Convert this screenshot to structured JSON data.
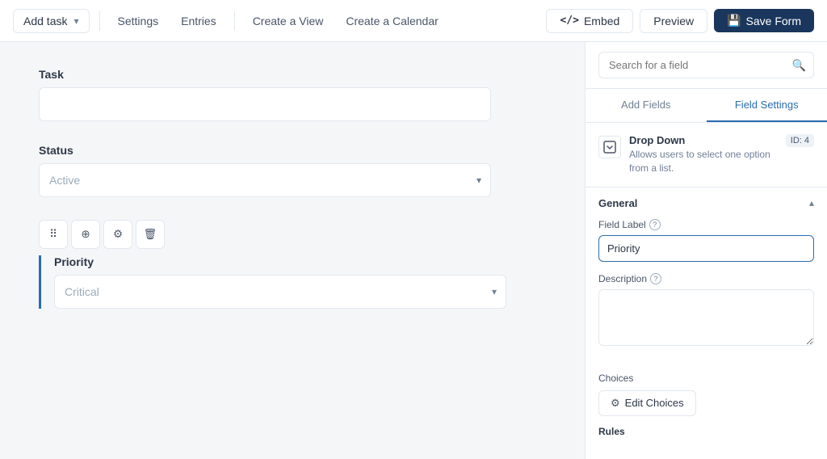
{
  "nav": {
    "add_task_label": "Add task",
    "settings_label": "Settings",
    "entries_label": "Entries",
    "create_view_label": "Create a View",
    "create_calendar_label": "Create a Calendar",
    "embed_label": "Embed",
    "preview_label": "Preview",
    "save_label": "Save Form"
  },
  "form": {
    "task_label": "Task",
    "task_placeholder": "",
    "status_label": "Status",
    "status_placeholder": "Active",
    "priority_label": "Priority",
    "priority_placeholder": "Critical"
  },
  "right_panel": {
    "search_placeholder": "Search for a field",
    "tab_add_fields": "Add Fields",
    "tab_field_settings": "Field Settings",
    "active_tab": "field_settings",
    "field_type": {
      "name": "Drop Down",
      "description": "Allows users to select one option from a list.",
      "id_label": "ID: 4"
    },
    "general_section": "General",
    "field_label_label": "Field Label",
    "field_label_help": "?",
    "field_label_value": "Priority",
    "description_label": "Description",
    "description_help": "?",
    "description_value": "",
    "choices_label": "Choices",
    "edit_choices_label": "Edit Choices",
    "rules_label": "Rules"
  },
  "icons": {
    "embed_code": "</>",
    "save_disk": "💾",
    "dropdown_field": "⬇",
    "search": "🔍",
    "chevron_down": "▾",
    "chevron_up": "▴",
    "gear": "⚙"
  }
}
